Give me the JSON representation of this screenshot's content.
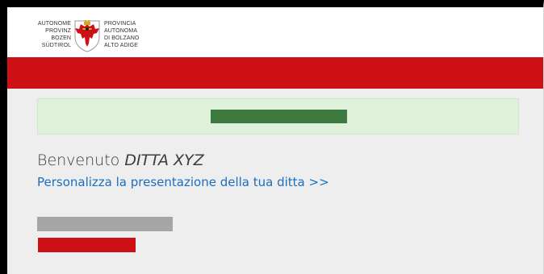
{
  "header": {
    "logo_left_lines": [
      "AUTONOME",
      "PROVINZ",
      "BOZEN",
      "SÜDTIROL"
    ],
    "logo_right_lines": [
      "PROVINCIA",
      "AUTONOMA",
      "DI BOLZANO",
      "ALTO ADIGE"
    ],
    "emblem_icon": "eagle-coat-of-arms-icon"
  },
  "colors": {
    "brand_red": "#cc1016",
    "notice_bg": "#dff1db",
    "notice_bar": "#3e7940",
    "link_blue": "#1a6fc0",
    "content_bg": "#eeeeee"
  },
  "main": {
    "welcome_prefix": "Benvenuto",
    "company_name": "DITTA XYZ",
    "personalize_link": "Personalizza la presentazione della tua ditta >>"
  }
}
